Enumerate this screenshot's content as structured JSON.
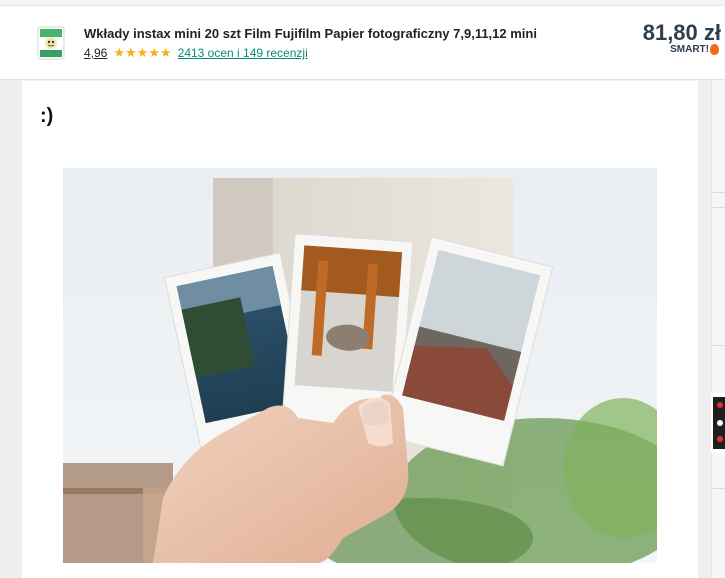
{
  "product": {
    "title": "Wkłady instax mini 20 szt Film Fujifilm Papier fotograficzny 7,9,11,12 mini",
    "rating": "4,96",
    "stars": "★★★★★",
    "reviews": "2413 ocen i 149 recenzji",
    "price": "81,80 zł",
    "smart_label": "SMART!"
  },
  "content": {
    "heading": ":)"
  },
  "icons": {
    "thumbnail": "instax-film-box-icon",
    "smart": "smart-badge-icon"
  },
  "colors": {
    "star": "#f2b01e",
    "link": "#0a8a7a",
    "price": "#2f3e4e",
    "smart_accent": "#f06a1c"
  }
}
